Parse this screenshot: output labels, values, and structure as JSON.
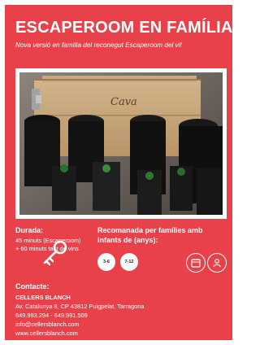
{
  "header": {
    "title": "ESCAPEROOM EN FAMÍLIA",
    "subtitle": "Nova versió en família del reconegut Escaperoom del vi!"
  },
  "photo": {
    "box_label": "Cava"
  },
  "icons": [
    "key-icon",
    "calendar-icon",
    "person-icon"
  ],
  "duration": {
    "label": "Durada:",
    "line1": "45 minuts (Escaperoom)",
    "line2": "+ 60 minuts tast de vins"
  },
  "recommended": {
    "label_line1": "Recomanada per famílies amb",
    "label_line2": "infants de (anys):",
    "ages": [
      "3-6",
      "7-12"
    ]
  },
  "contact": {
    "label": "Contacte:",
    "company": "CELLERS BLANCH",
    "address": "Av. Catalunya 8, CP 43812 Puigpelat, Tarragona",
    "phones": "649.993.294 - 649.991.509",
    "email": "info@cellersblanch.com",
    "web": "www.cellersblanch.com"
  },
  "colors": {
    "accent": "#e8414a",
    "text": "#ffffff"
  }
}
